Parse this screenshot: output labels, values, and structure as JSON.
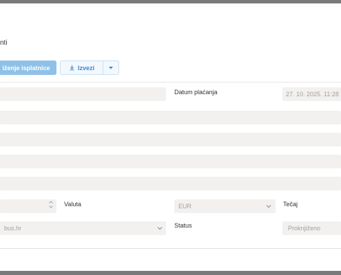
{
  "page": {
    "subtitle": "nti"
  },
  "toolbar": {
    "primary_label": "iženje isplatnice",
    "export_label": "Izvezi",
    "export_icon": "download-icon",
    "dropdown_icon": "caret-down-icon"
  },
  "form": {
    "payment_date_label": "Datum plaćanja",
    "payment_date_value": "27. 10. 2025. 11:28",
    "currency_label": "Valuta",
    "currency_value": "EUR",
    "rate_label": "Tečaj",
    "domain_value": "bus.hr",
    "status_label": "Status",
    "status_value": "Proknjiženo"
  },
  "colors": {
    "accent": "#3a88d1",
    "primary_button": "#8fc1e8",
    "field_bg": "#f2f1f0",
    "frame": "#7a7a7a"
  }
}
